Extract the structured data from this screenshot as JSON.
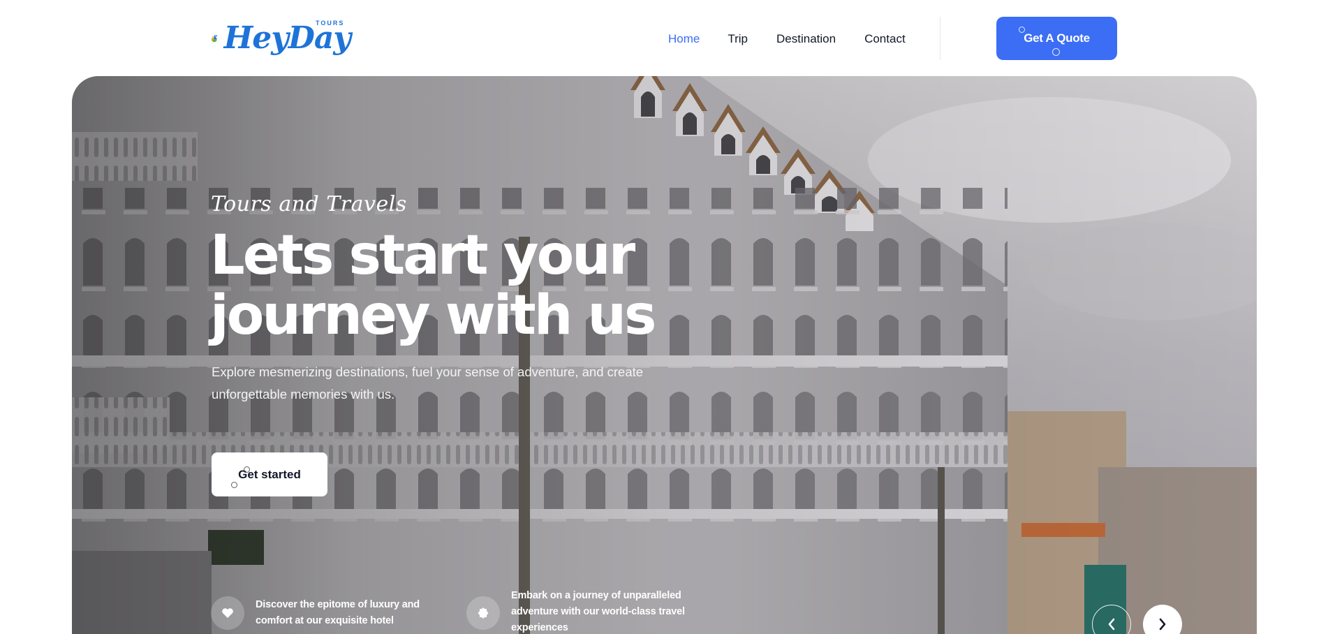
{
  "brand": {
    "name": "HeyDay",
    "subtitle": "TOURS"
  },
  "nav": {
    "items": [
      "Home",
      "Trip",
      "Destination",
      "Contact"
    ],
    "active_index": 0
  },
  "header": {
    "quote_button": "Get A Quote"
  },
  "hero": {
    "tagline": "Tours and Travels",
    "headline_line1": "Lets start your",
    "headline_line2": "journey with us",
    "description": "Explore mesmerizing destinations, fuel your sense of adventure, and create unforgettable memories with us.",
    "cta_label": "Get started"
  },
  "features": [
    {
      "icon": "heart-icon",
      "text": "Discover the epitome of luxury and comfort at our exquisite hotel"
    },
    {
      "icon": "badge-check-icon",
      "text": "Embark on a journey of unparalleled adventure with our world-class travel experiences"
    }
  ],
  "slider": {
    "prev_icon": "chevron-left-icon",
    "next_icon": "chevron-right-icon"
  },
  "colors": {
    "accent": "#3b6ef5",
    "nav_active": "#3b6ef5",
    "text": "#111827",
    "white": "#ffffff"
  }
}
